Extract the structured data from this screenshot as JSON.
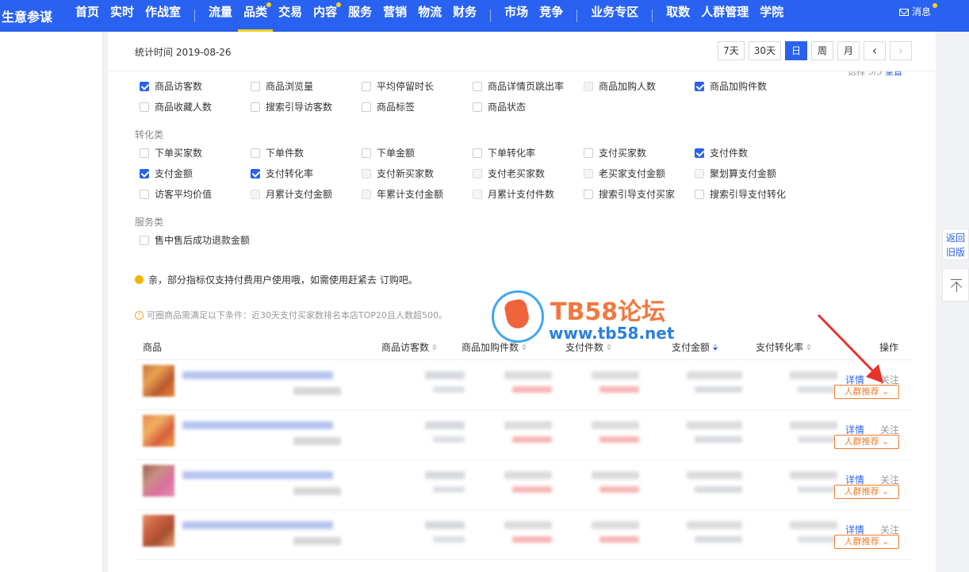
{
  "nav": {
    "brand": "生意参谋",
    "items": [
      {
        "label": "首页",
        "active": false,
        "dot": false
      },
      {
        "label": "实时",
        "active": false,
        "dot": false
      },
      {
        "label": "作战室",
        "active": false,
        "dot": false
      },
      {
        "label": "流量",
        "active": false,
        "dot": false,
        "sep_before": true
      },
      {
        "label": "品类",
        "active": true,
        "dot": true
      },
      {
        "label": "交易",
        "active": false,
        "dot": false
      },
      {
        "label": "内容",
        "active": false,
        "dot": true
      },
      {
        "label": "服务",
        "active": false,
        "dot": false
      },
      {
        "label": "营销",
        "active": false,
        "dot": false
      },
      {
        "label": "物流",
        "active": false,
        "dot": false
      },
      {
        "label": "财务",
        "active": false,
        "dot": false
      },
      {
        "label": "市场",
        "active": false,
        "dot": false,
        "sep_before": true
      },
      {
        "label": "竞争",
        "active": false,
        "dot": false
      },
      {
        "label": "业务专区",
        "active": false,
        "dot": false,
        "sep_before": true
      },
      {
        "label": "取数",
        "active": false,
        "dot": false,
        "sep_before": true
      },
      {
        "label": "人群管理",
        "active": false,
        "dot": false
      },
      {
        "label": "学院",
        "active": false,
        "dot": false
      }
    ],
    "message": "消息"
  },
  "stats": {
    "time_label": "统计时间 2019-08-26",
    "ranges": [
      "7天",
      "30天",
      "日",
      "周",
      "月"
    ],
    "active_range": "日",
    "prev_icon": "chevron-left-icon",
    "next_icon": "chevron-right-icon"
  },
  "selection": {
    "count_text": "选择 5/5",
    "reset_link": "重置"
  },
  "groups": {
    "conversion_title": "转化类",
    "service_title": "服务类"
  },
  "metrics": {
    "row1": [
      {
        "label": "商品访客数",
        "checked": true
      },
      {
        "label": "商品浏览量",
        "checked": false
      },
      {
        "label": "平均停留时长",
        "checked": false
      },
      {
        "label": "商品详情页跳出率",
        "checked": false
      },
      {
        "label": "商品加购人数",
        "checked": false,
        "disabled": true
      },
      {
        "label": "商品加购件数",
        "checked": true
      }
    ],
    "row2": [
      {
        "label": "商品收藏人数",
        "checked": false
      },
      {
        "label": "搜索引导访客数",
        "checked": false
      },
      {
        "label": "商品标签",
        "checked": false
      },
      {
        "label": "商品状态",
        "checked": false
      }
    ],
    "row3": [
      {
        "label": "下单买家数",
        "checked": false
      },
      {
        "label": "下单件数",
        "checked": false
      },
      {
        "label": "下单金额",
        "checked": false
      },
      {
        "label": "下单转化率",
        "checked": false
      },
      {
        "label": "支付买家数",
        "checked": false
      },
      {
        "label": "支付件数",
        "checked": true
      }
    ],
    "row4": [
      {
        "label": "支付金额",
        "checked": true
      },
      {
        "label": "支付转化率",
        "checked": true
      },
      {
        "label": "支付新买家数",
        "checked": false,
        "disabled": true
      },
      {
        "label": "支付老买家数",
        "checked": false,
        "disabled": true
      },
      {
        "label": "老买家支付金额",
        "checked": false,
        "disabled": true
      },
      {
        "label": "聚划算支付金额",
        "checked": false,
        "disabled": true
      }
    ],
    "row5": [
      {
        "label": "访客平均价值",
        "checked": false
      },
      {
        "label": "月累计支付金额",
        "checked": false,
        "disabled": true
      },
      {
        "label": "年累计支付金额",
        "checked": false,
        "disabled": true
      },
      {
        "label": "月累计支付件数",
        "checked": false,
        "disabled": true
      },
      {
        "label": "搜索引导支付买家",
        "checked": false
      },
      {
        "label": "搜索引导支付转化",
        "checked": false
      }
    ],
    "row6": [
      {
        "label": "售中售后成功退款金额",
        "checked": false
      }
    ]
  },
  "notices": {
    "paid_notice": "亲，部分指标仅支持付费用户使用哦，如需使用赶紧去 订购吧。",
    "condition_notice": "可圈商品需满足以下条件：近30天支付买家数排名本店TOP20且人数超500。"
  },
  "watermark": {
    "title": "TB58论坛",
    "url": "www.tb58.net"
  },
  "table": {
    "headers": [
      "商品",
      "商品访客数",
      "商品加购件数",
      "支付件数",
      "支付金额",
      "支付转化率",
      "操作"
    ],
    "sorted_column": "支付金额",
    "row_actions": {
      "detail": "详情",
      "follow": "关注",
      "crowd": "人群推荐"
    },
    "rows": [
      {
        "thumb_colors": [
          "#c8783c",
          "#e8a050",
          "#b85a30",
          "#f08030"
        ]
      },
      {
        "thumb_colors": [
          "#e88850",
          "#f0b060",
          "#d86040",
          "#f0a040"
        ]
      },
      {
        "thumb_colors": [
          "#9a6050",
          "#c89080",
          "#d870a0",
          "#e890b0"
        ]
      },
      {
        "thumb_colors": [
          "#e09060",
          "#c86040",
          "#a85030",
          "#e8a070"
        ]
      }
    ]
  },
  "side_tools": {
    "back_line1": "返回",
    "back_line2": "旧版",
    "top_icon": "back-to-top-icon"
  }
}
